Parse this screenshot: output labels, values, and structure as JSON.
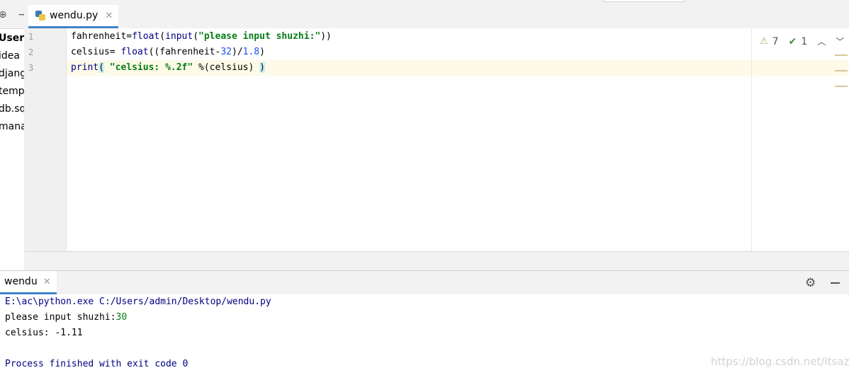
{
  "project": {
    "toolbar_icons": [
      "add-icon",
      "arrow-icon"
    ],
    "items": [
      "Users",
      "idea",
      "djang",
      "temp",
      "db.sq",
      "mana"
    ]
  },
  "editor": {
    "tab": {
      "label": "wendu.py",
      "icon": "python-file-icon"
    },
    "line_numbers": [
      "1",
      "2",
      "3"
    ],
    "lines": [
      "fahrenheit=float(input(\"please input shuzhi:\"))",
      "celsius= float((fahrenheit-32)/1.8)",
      "print( \"celsius: %.2f\" %(celsius) )"
    ],
    "inspections": {
      "warnings": "7",
      "ok": "1"
    }
  },
  "run": {
    "tab_label": "wendu",
    "console": {
      "command": "E:\\ac\\python.exe C:/Users/admin/Desktop/wendu.py",
      "prompt": "please input shuzhi:",
      "input": "30",
      "output": "celsius: -1.11",
      "exit": "Process finished with exit code 0"
    }
  },
  "watermark": "https://blog.csdn.net/ltsazx",
  "colors": {
    "accent": "#4083c9",
    "keyword": "#000080",
    "string": "#067d17",
    "number": "#1750eb"
  }
}
